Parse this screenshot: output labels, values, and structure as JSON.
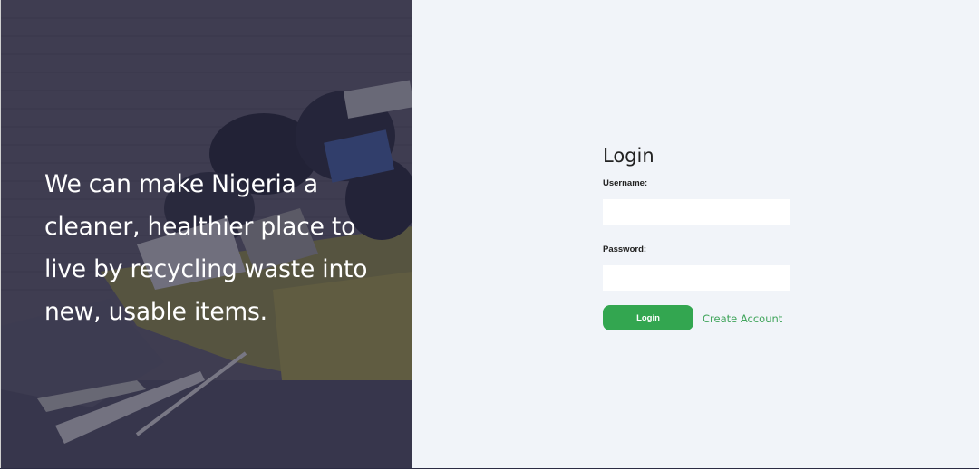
{
  "hero": {
    "tagline": "We can make Nigeria a cleaner, healthier place to live by recycling waste into new, usable items."
  },
  "login": {
    "title": "Login",
    "username_label": "Username:",
    "username_value": "",
    "password_label": "Password:",
    "password_value": "",
    "login_button": "Login",
    "create_account_link": "Create Account"
  },
  "colors": {
    "accent_green": "#33a650",
    "link_green": "#3fa45a",
    "panel_bg": "#f1f4f9",
    "hero_overlay": "#28284680"
  }
}
